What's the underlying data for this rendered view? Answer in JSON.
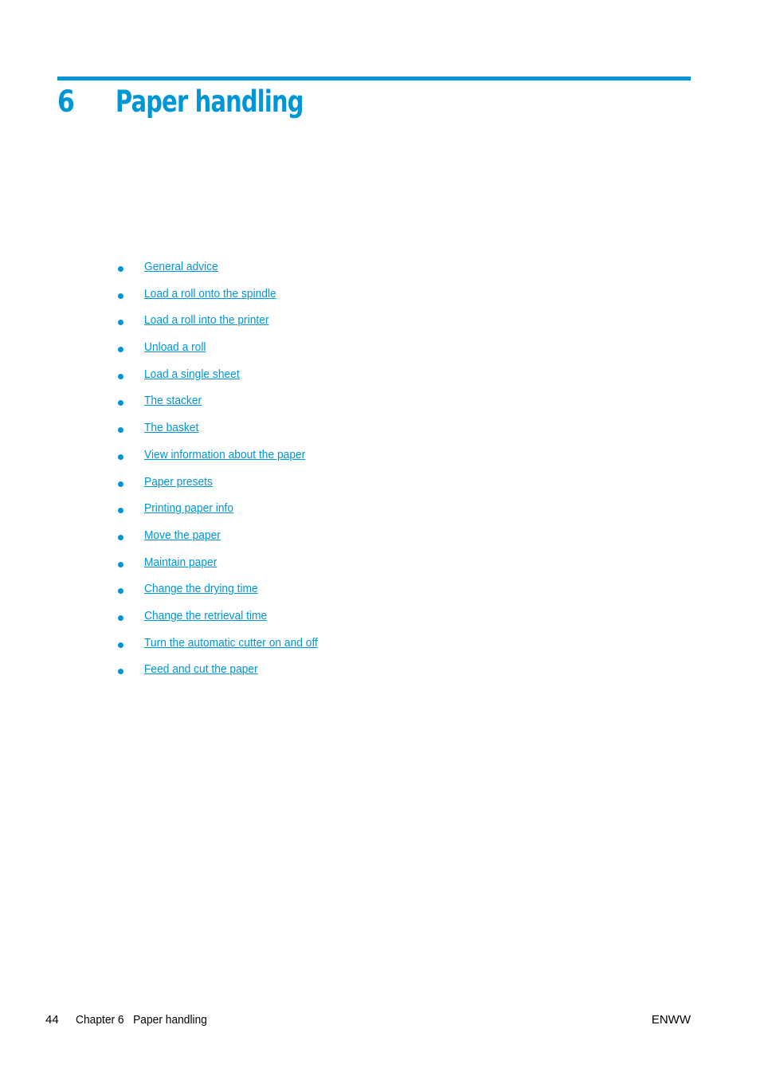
{
  "header": {
    "chapter_number": "6",
    "chapter_title": "Paper handling",
    "accent_color": "#0096d6"
  },
  "toc": {
    "items": [
      {
        "label": "General advice"
      },
      {
        "label": "Load a roll onto the spindle"
      },
      {
        "label": "Load a roll into the printer"
      },
      {
        "label": "Unload a roll"
      },
      {
        "label": "Load a single sheet"
      },
      {
        "label": "The stacker"
      },
      {
        "label": "The basket"
      },
      {
        "label": "View information about the paper"
      },
      {
        "label": "Paper presets"
      },
      {
        "label": "Printing paper info"
      },
      {
        "label": "Move the paper"
      },
      {
        "label": "Maintain paper"
      },
      {
        "label": "Change the drying time"
      },
      {
        "label": "Change the retrieval time"
      },
      {
        "label": "Turn the automatic cutter on and off"
      },
      {
        "label": "Feed and cut the paper"
      }
    ]
  },
  "footer": {
    "page_number": "44",
    "chapter_ref": "Chapter 6   Paper handling",
    "right_text": "ENWW"
  }
}
